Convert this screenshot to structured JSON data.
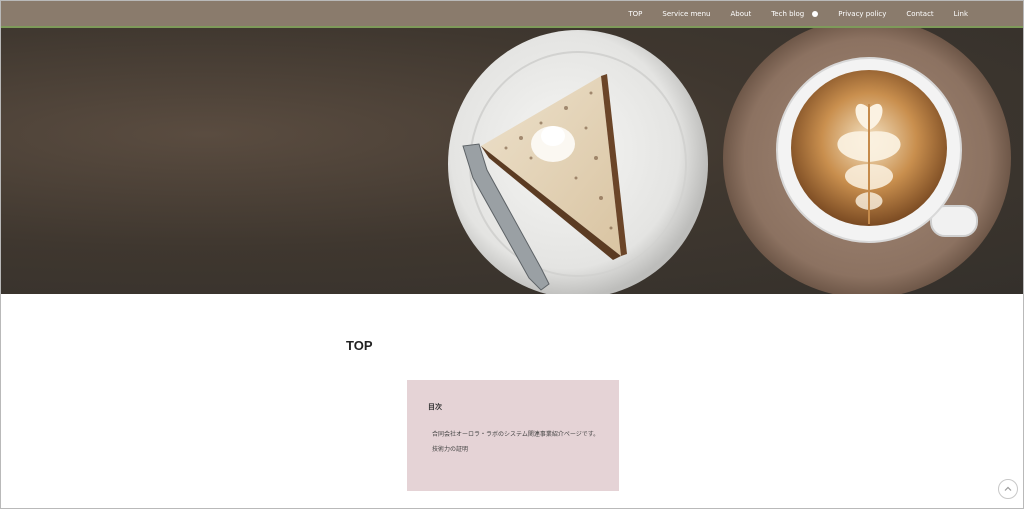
{
  "nav": {
    "items": [
      {
        "label": "TOP"
      },
      {
        "label": "Service menu"
      },
      {
        "label": "About"
      },
      {
        "label": "Tech blog",
        "has_indicator": true
      },
      {
        "label": "Privacy policy"
      },
      {
        "label": "Contact"
      },
      {
        "label": "Link"
      }
    ],
    "bg_color": "#8a7b6c",
    "accent_color": "#7e9a5a"
  },
  "hero": {
    "image": "cake-slice-and-latte-on-dark-table"
  },
  "main": {
    "title": "TOP"
  },
  "toc": {
    "heading": "目次",
    "items": [
      {
        "label": "合同会社オーロラ・ラボのシステム関連事業紹介ページです。"
      },
      {
        "label": "技術力の証明"
      }
    ],
    "bg_color": "#e5d3d6"
  },
  "back_to_top": {
    "icon": "chevron-up-icon"
  }
}
